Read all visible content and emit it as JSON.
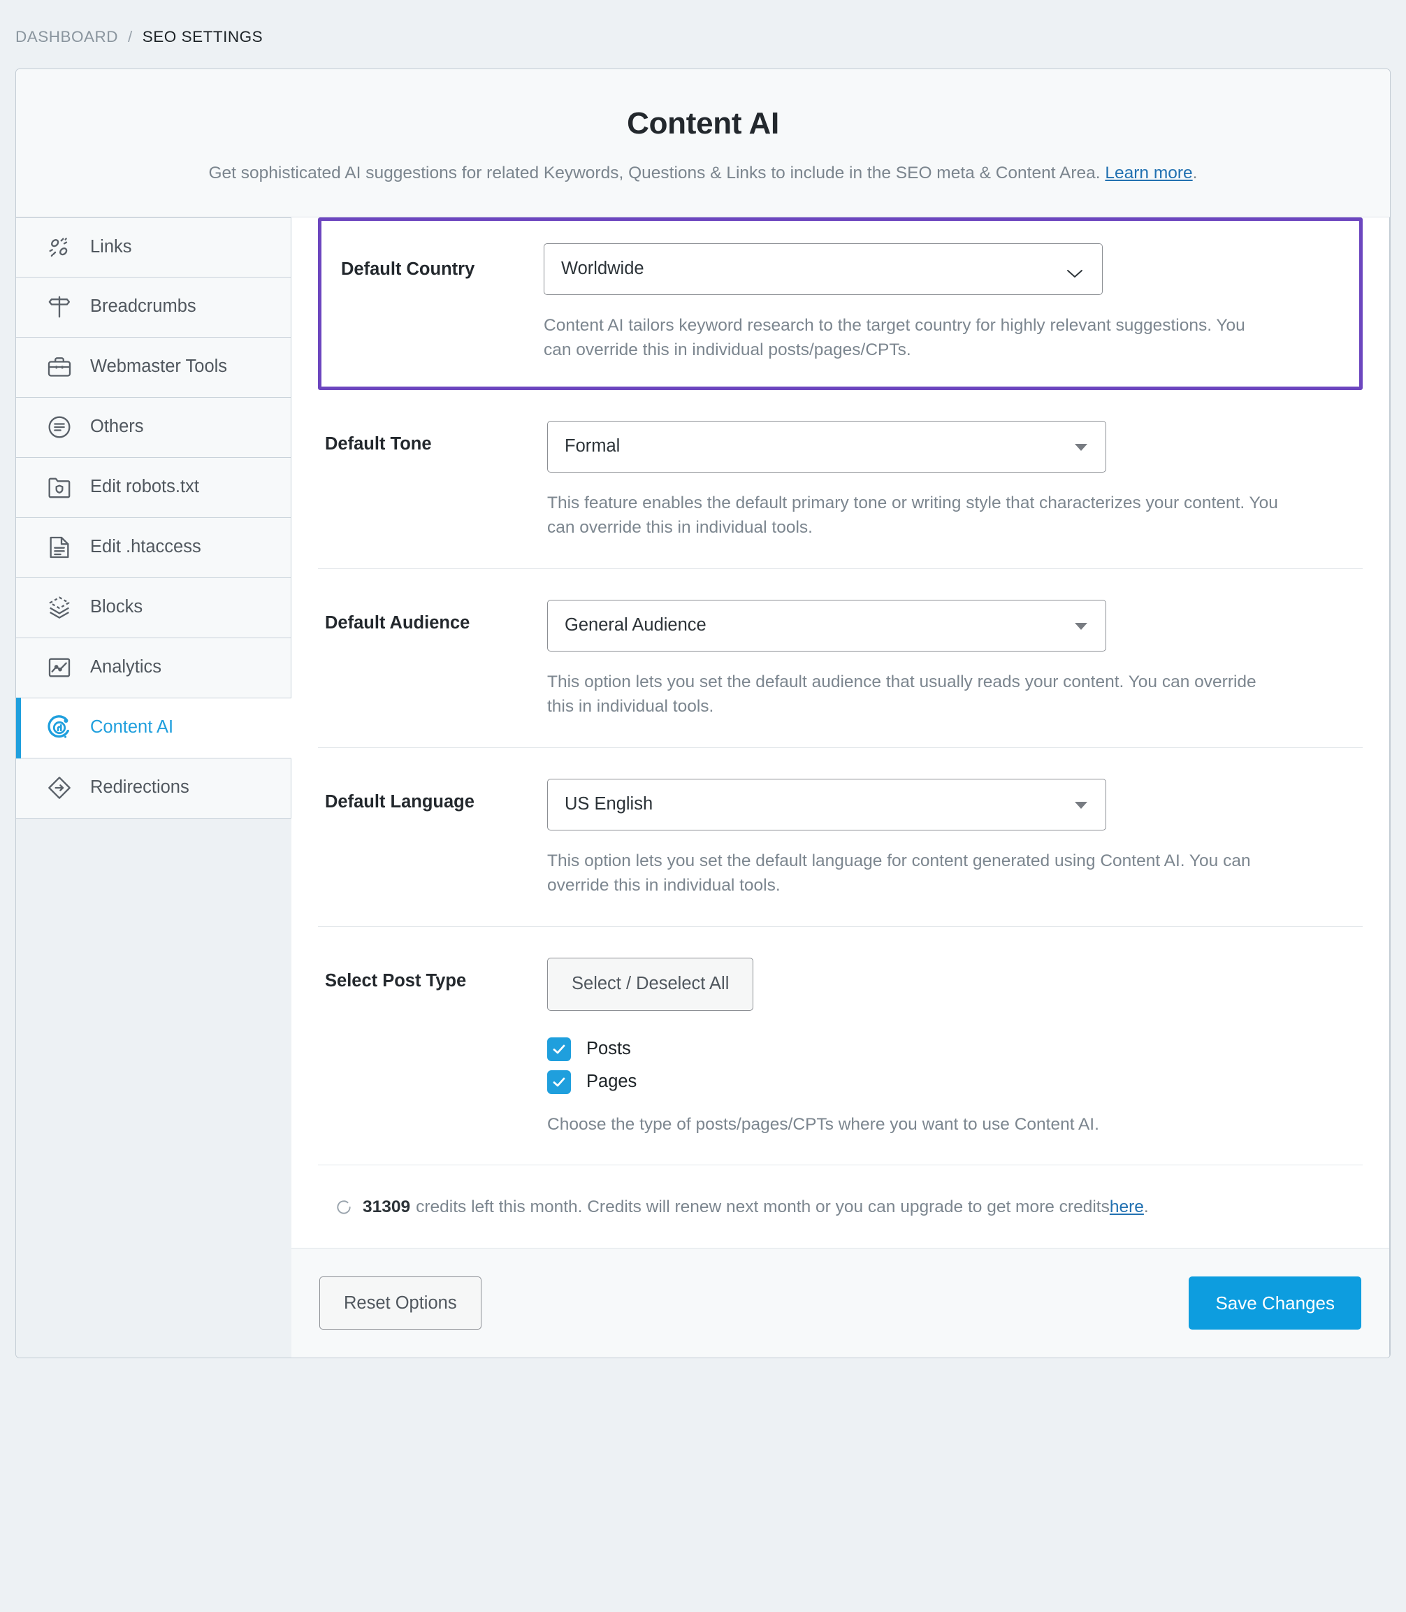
{
  "breadcrumb": {
    "root": "DASHBOARD",
    "separator": "/",
    "current": "SEO SETTINGS"
  },
  "header": {
    "title": "Content AI",
    "description_before": "Get sophisticated AI suggestions for related Keywords, Questions & Links to include in the SEO meta & Content Area. ",
    "learn_more": "Learn more",
    "description_after": "."
  },
  "sidebar": {
    "items": [
      {
        "label": "Links",
        "icon": "links-icon",
        "active": false
      },
      {
        "label": "Breadcrumbs",
        "icon": "signpost-icon",
        "active": false
      },
      {
        "label": "Webmaster Tools",
        "icon": "briefcase-icon",
        "active": false
      },
      {
        "label": "Others",
        "icon": "list-circle-icon",
        "active": false
      },
      {
        "label": "Edit robots.txt",
        "icon": "folder-shield-icon",
        "active": false
      },
      {
        "label": "Edit .htaccess",
        "icon": "file-lines-icon",
        "active": false
      },
      {
        "label": "Blocks",
        "icon": "layers-icon",
        "active": false
      },
      {
        "label": "Analytics",
        "icon": "chart-icon",
        "active": false
      },
      {
        "label": "Content AI",
        "icon": "content-ai-icon",
        "active": true
      },
      {
        "label": "Redirections",
        "icon": "redirect-arrow-icon",
        "active": false
      }
    ]
  },
  "fields": {
    "country": {
      "label": "Default Country",
      "value": "Worldwide",
      "help": "Content AI tailors keyword research to the target country for highly relevant suggestions. You can override this in individual posts/pages/CPTs.",
      "highlighted": true
    },
    "tone": {
      "label": "Default Tone",
      "value": "Formal",
      "help": "This feature enables the default primary tone or writing style that characterizes your content. You can override this in individual tools."
    },
    "audience": {
      "label": "Default Audience",
      "value": "General Audience",
      "help": "This option lets you set the default audience that usually reads your content. You can override this in individual tools."
    },
    "language": {
      "label": "Default Language",
      "value": "US English",
      "help": "This option lets you set the default language for content generated using Content AI. You can override this in individual tools."
    },
    "post_type": {
      "label": "Select Post Type",
      "toggle_all_label": "Select / Deselect All",
      "options": [
        {
          "label": "Posts",
          "checked": true
        },
        {
          "label": "Pages",
          "checked": true
        }
      ],
      "help": "Choose the type of posts/pages/CPTs where you want to use Content AI."
    }
  },
  "credits": {
    "amount": "31309",
    "text": "credits left this month. Credits will renew next month or you can upgrade to get more credits ",
    "link": "here",
    "suffix": "."
  },
  "footer": {
    "reset_label": "Reset Options",
    "save_label": "Save Changes"
  },
  "colors": {
    "accent_blue": "#0d9ddf",
    "highlight_purple": "#6c46bf",
    "link_blue": "#2271b1",
    "page_background": "#edf1f4"
  }
}
